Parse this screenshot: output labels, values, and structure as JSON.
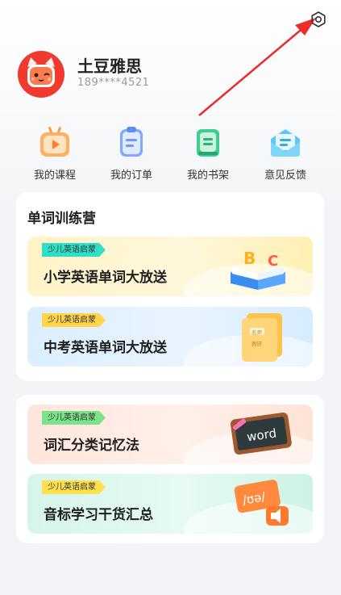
{
  "profile": {
    "name": "土豆雅思",
    "phone": "189****4521"
  },
  "actions": [
    {
      "label": "我的课程",
      "icon": "video-icon"
    },
    {
      "label": "我的订单",
      "icon": "order-clipboard-icon"
    },
    {
      "label": "我的书架",
      "icon": "book-icon"
    },
    {
      "label": "意见反馈",
      "icon": "feedback-envelope-icon"
    }
  ],
  "section1": {
    "title": "单词训练营",
    "banners": [
      {
        "tag": "少儿英语启蒙",
        "title": "小学英语单词大放送",
        "art": "abc-book"
      },
      {
        "tag": "少儿英语启蒙",
        "title": "中考英语单词大放送",
        "art": "folder"
      }
    ]
  },
  "section2": {
    "banners": [
      {
        "tag": "少儿英语启蒙",
        "title": "词汇分类记忆法",
        "art_text": "word"
      },
      {
        "tag": "少儿英语启蒙",
        "title": "音标学习干货汇总",
        "art_text": "/ʊə/"
      }
    ]
  },
  "art": {
    "abc_letters": [
      "B",
      "C"
    ],
    "folder_labels": [
      "名师",
      "教研"
    ]
  },
  "colors": {
    "avatar": "#f03a2e",
    "tag_yellow_bg": "#2ee0c8",
    "tag_blue_bg": "#ffd54a",
    "tag_orange_bg": "#7be38a",
    "tag_green_bg": "#ffe14d",
    "arrow": "#ee2a2a"
  }
}
